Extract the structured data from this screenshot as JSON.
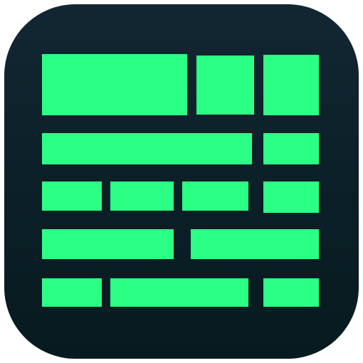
{
  "icon": {
    "name": "table-layout-app-icon",
    "background_color": "#0b1f27",
    "glyph_color": "#2cff86"
  }
}
